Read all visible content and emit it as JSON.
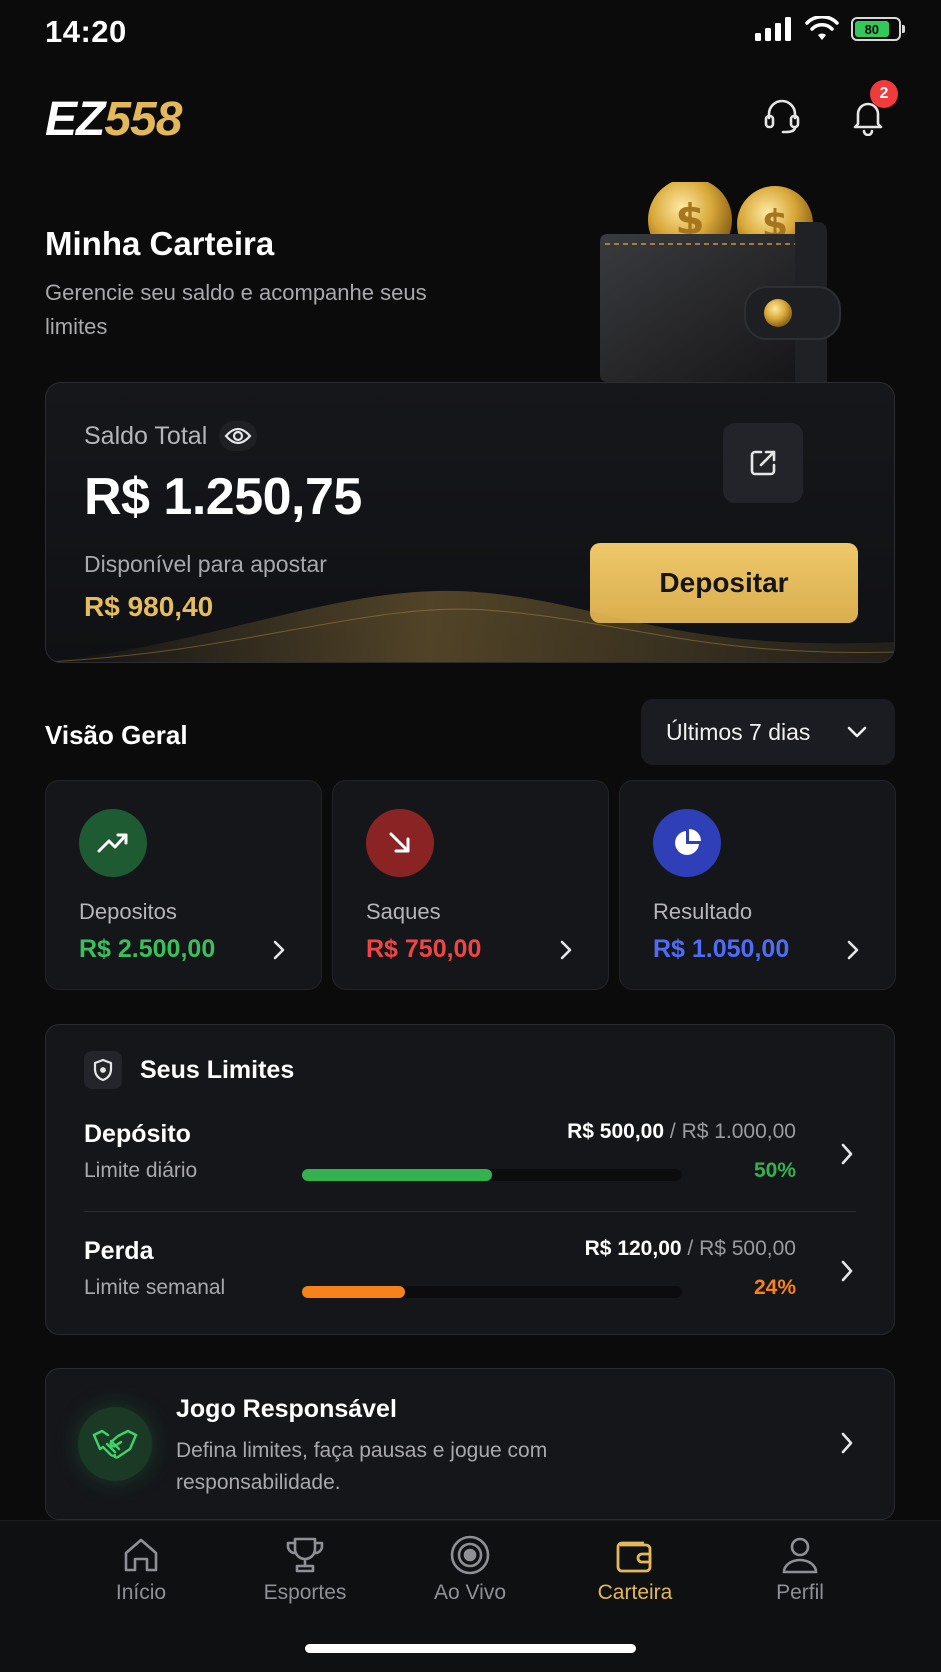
{
  "status_bar": {
    "time": "14:20",
    "battery": "80"
  },
  "header": {
    "logo_part1": "EZ",
    "logo_part2": "558",
    "notification_count": "2"
  },
  "page": {
    "title": "Minha Carteira",
    "subtitle": "Gerencie seu saldo e acompanhe seus limites"
  },
  "balance": {
    "label": "Saldo Total",
    "value": "R$ 1.250,75",
    "available_label": "Disponível para apostar",
    "available_value": "R$ 980,40",
    "deposit_label": "Depositar"
  },
  "overview": {
    "title": "Visão Geral",
    "period": "Últimos 7 dias",
    "cards": [
      {
        "label": "Depositos",
        "value": "R$ 2.500,00",
        "color": "#3bbf5c"
      },
      {
        "label": "Saques",
        "value": "R$ 750,00",
        "color": "#f04545"
      },
      {
        "label": "Resultado",
        "value": "R$ 1.050,00",
        "color": "#4f6cf5"
      }
    ]
  },
  "limits": {
    "title": "Seus Limites",
    "items": [
      {
        "name": "Depósito",
        "sub": "Limite diário",
        "used": "R$ 500,00",
        "separator": " / ",
        "total": "R$ 1.000,00",
        "percent": "50%",
        "fraction": 0.5,
        "color": "#35b24f"
      },
      {
        "name": "Perda",
        "sub": "Limite semanal",
        "used": "R$ 120,00",
        "separator": " / ",
        "total": "R$ 500,00",
        "percent": "24%",
        "fraction": 0.27,
        "color": "#f7821b"
      }
    ]
  },
  "responsible": {
    "title": "Jogo Responsável",
    "description": "Defina limites, faça pausas e jogue com responsabilidade."
  },
  "nav": {
    "items": [
      {
        "label": "Início"
      },
      {
        "label": "Esportes"
      },
      {
        "label": "Ao Vivo"
      },
      {
        "label": "Carteira"
      },
      {
        "label": "Perfil"
      }
    ]
  }
}
